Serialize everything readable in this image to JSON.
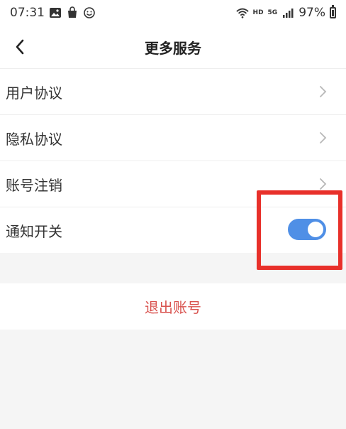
{
  "status_bar": {
    "time": "07:31",
    "hd": "HD",
    "net": "5G",
    "battery": "97%",
    "icons": [
      "image-icon",
      "bag-icon",
      "emoji-icon",
      "wifi-icon",
      "signal-icon",
      "battery-icon"
    ]
  },
  "header": {
    "title": "更多服务",
    "back_icon": "chevron-left-icon"
  },
  "settings": {
    "items": [
      {
        "label": "用户协议",
        "type": "link"
      },
      {
        "label": "隐私协议",
        "type": "link"
      },
      {
        "label": "账号注销",
        "type": "link"
      },
      {
        "label": "通知开关",
        "type": "toggle",
        "on": true
      }
    ]
  },
  "logout": {
    "label": "退出账号"
  },
  "colors": {
    "toggle_on": "#4f8fe6",
    "logout_text": "#d9534f",
    "highlight_border": "#e8302a",
    "background": "#f5f5f5"
  }
}
